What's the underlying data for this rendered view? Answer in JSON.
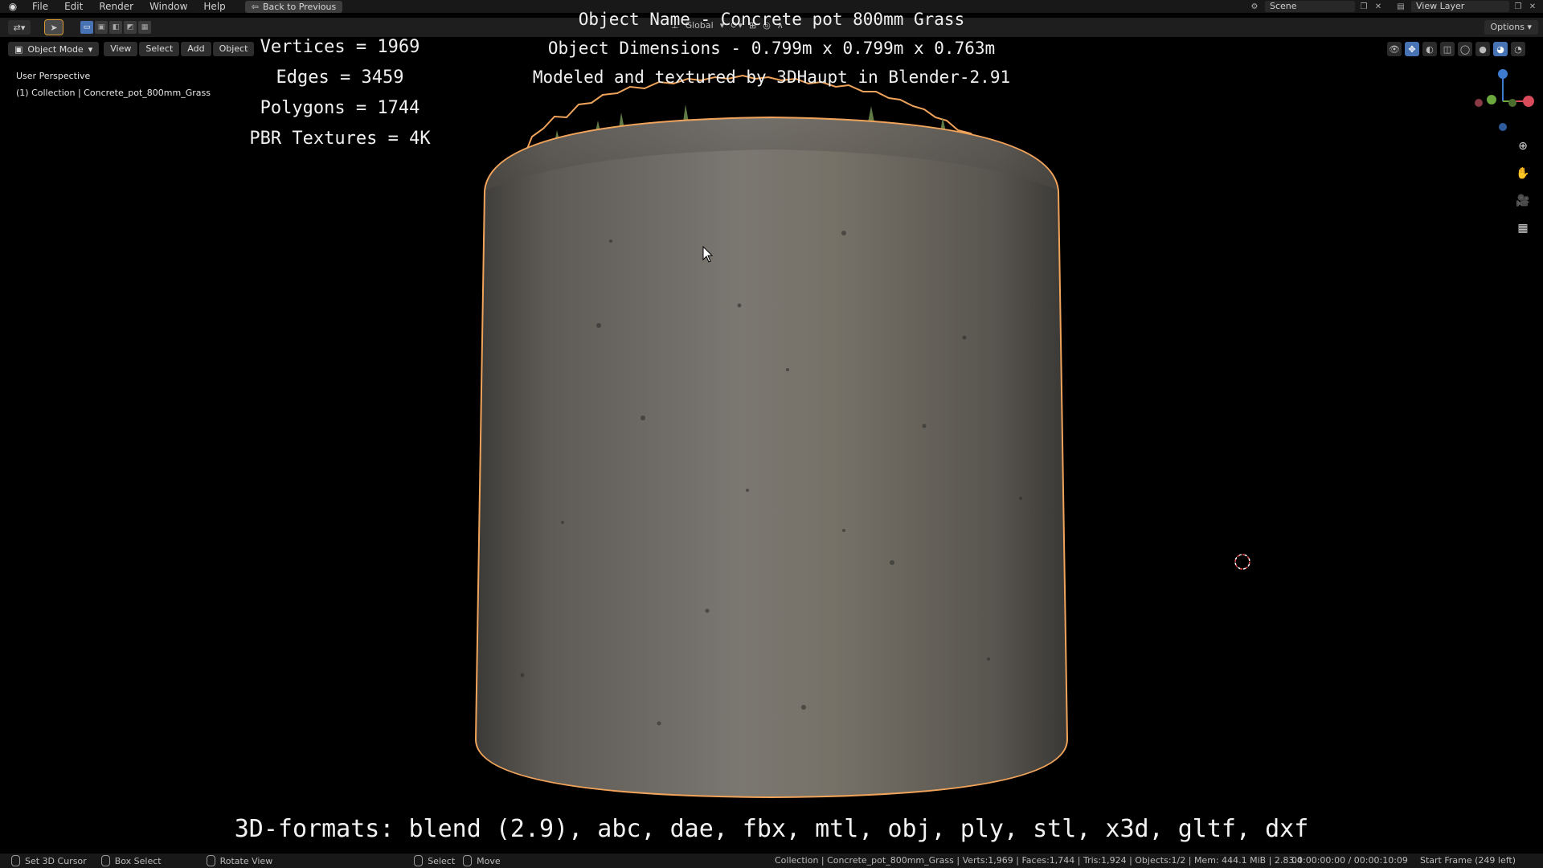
{
  "topbar": {
    "menus": [
      "File",
      "Edit",
      "Render",
      "Window",
      "Help"
    ],
    "back_button": "Back to Previous",
    "scene": "Scene",
    "view_layer": "View Layer"
  },
  "toolheader": {
    "orientation": "Global",
    "options": "Options"
  },
  "viewport_header": {
    "mode": "Object Mode",
    "menus": [
      "View",
      "Select",
      "Add",
      "Object"
    ]
  },
  "viewport_info": {
    "perspective": "User Perspective",
    "collection": "(1) Collection | Concrete_pot_800mm_Grass"
  },
  "overlay": {
    "title": "Object Name - Concrete pot 800mm Grass",
    "dimensions": "Object Dimensions -  0.799m x 0.799m x 0.763m",
    "credit": "Modeled and textured by 3DHaupt in Blender-2.91",
    "vertices": "Vertices = 1969",
    "edges": "Edges = 3459",
    "polygons": "Polygons = 1744",
    "textures": "PBR Textures = 4K",
    "formats": "3D-formats: blend (2.9), abc, dae, fbx, mtl, obj, ply, stl, x3d, gltf, dxf"
  },
  "statusbar": {
    "hints": [
      "Set 3D Cursor",
      "Box Select",
      "Rotate View",
      "Select",
      "Move"
    ],
    "info": "Collection | Concrete_pot_800mm_Grass | Verts:1,969 | Faces:1,744 | Tris:1,924 | Objects:1/2 | Mem: 444.1 MiB | 2.83.4",
    "time": "00:00:00:00 / 00:00:10:09",
    "frame": "Start Frame (249 left)"
  },
  "colors": {
    "selection_outline": "#f0a35a",
    "active_blue": "#4772b3",
    "pot_gray": "#6e6a64"
  }
}
